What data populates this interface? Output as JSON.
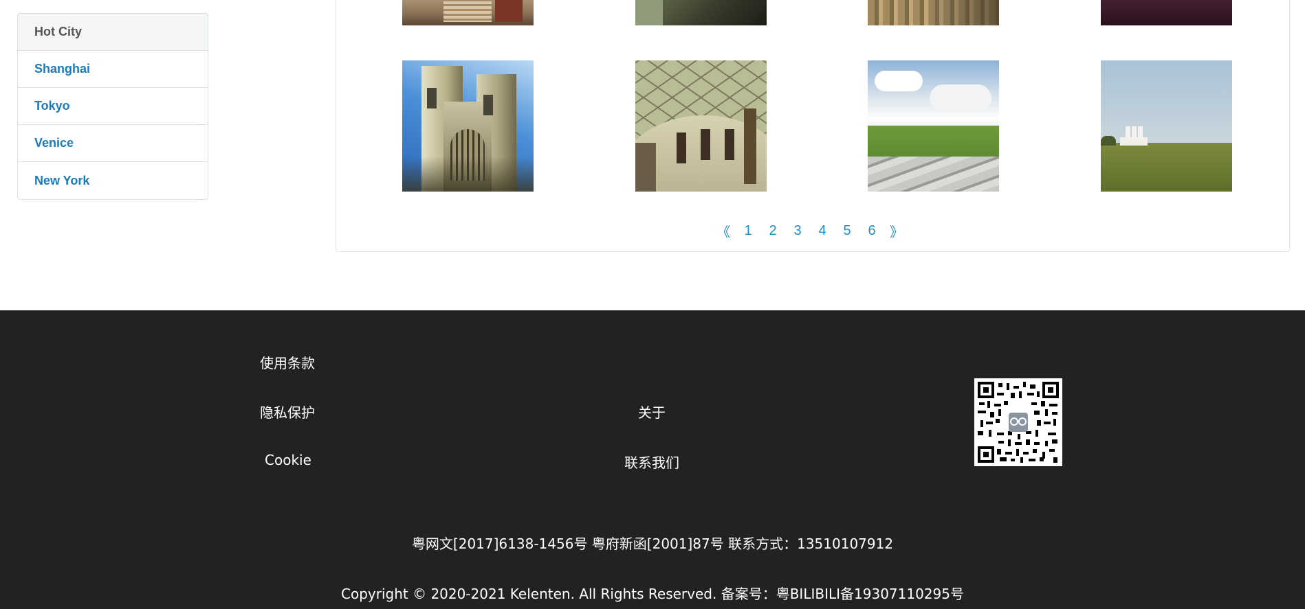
{
  "sidebar": {
    "title": "Hot City",
    "items": [
      {
        "label": "Shanghai"
      },
      {
        "label": "Tokyo"
      },
      {
        "label": "Venice"
      },
      {
        "label": "New York"
      }
    ]
  },
  "gallery": {
    "thumbnails": [
      {
        "name": "thumb-row1-1"
      },
      {
        "name": "thumb-row1-2"
      },
      {
        "name": "thumb-row1-3"
      },
      {
        "name": "thumb-row1-4"
      },
      {
        "name": "westminster-abbey-photo"
      },
      {
        "name": "british-museum-great-court-photo"
      },
      {
        "name": "rocky-meadow-clouds-photo"
      },
      {
        "name": "green-field-white-building-photo"
      }
    ]
  },
  "pager": {
    "prev": "《",
    "pages": [
      "1",
      "2",
      "3",
      "4",
      "5",
      "6"
    ],
    "next": "》",
    "accent": "#1f8fc8"
  },
  "footer": {
    "links": {
      "terms": "使用条款",
      "privacy": "隐私保护",
      "cookie": "Cookie",
      "about": "关于",
      "contact": "联系我们"
    },
    "license_line": "粤网文[2017]6138-1456号 粤府新函[2001]87号 联系方式：13510107912",
    "copyright_line": "Copyright © 2020-2021 Kelenten. All Rights Reserved. 备案号：粤BILIBILI备19307110295号",
    "background": "#222222"
  }
}
